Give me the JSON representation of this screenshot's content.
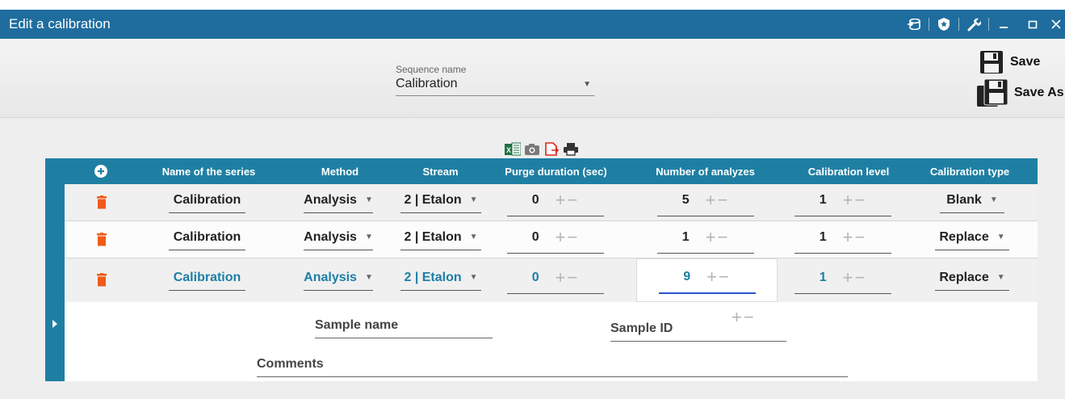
{
  "window": {
    "title": "Edit a calibration"
  },
  "header": {
    "sequence_label": "Sequence name",
    "sequence_value": "Calibration",
    "save_label": "Save",
    "save_as_label": "Save As"
  },
  "columns": {
    "series": "Name of the series",
    "method": "Method",
    "stream": "Stream",
    "purge": "Purge duration (sec)",
    "analyzes": "Number of analyzes",
    "level": "Calibration level",
    "type": "Calibration type"
  },
  "rows": [
    {
      "series": "Calibration",
      "method": "Analysis",
      "stream": "2 | Etalon",
      "purge": "0",
      "analyzes": "5",
      "level": "1",
      "type": "Blank"
    },
    {
      "series": "Calibration",
      "method": "Analysis",
      "stream": "2 | Etalon",
      "purge": "0",
      "analyzes": "1",
      "level": "1",
      "type": "Replace"
    },
    {
      "series": "Calibration",
      "method": "Analysis",
      "stream": "2 | Etalon",
      "purge": "0",
      "analyzes": "9",
      "level": "1",
      "type": "Replace"
    }
  ],
  "detail": {
    "sample_name_label": "Sample name",
    "sample_id_label": "Sample ID",
    "comments_label": "Comments"
  },
  "colors": {
    "accent": "#1f7fa3",
    "titlebar": "#1f6d9e",
    "delete": "#f05a1a",
    "selected_text": "#1b7fa6"
  }
}
